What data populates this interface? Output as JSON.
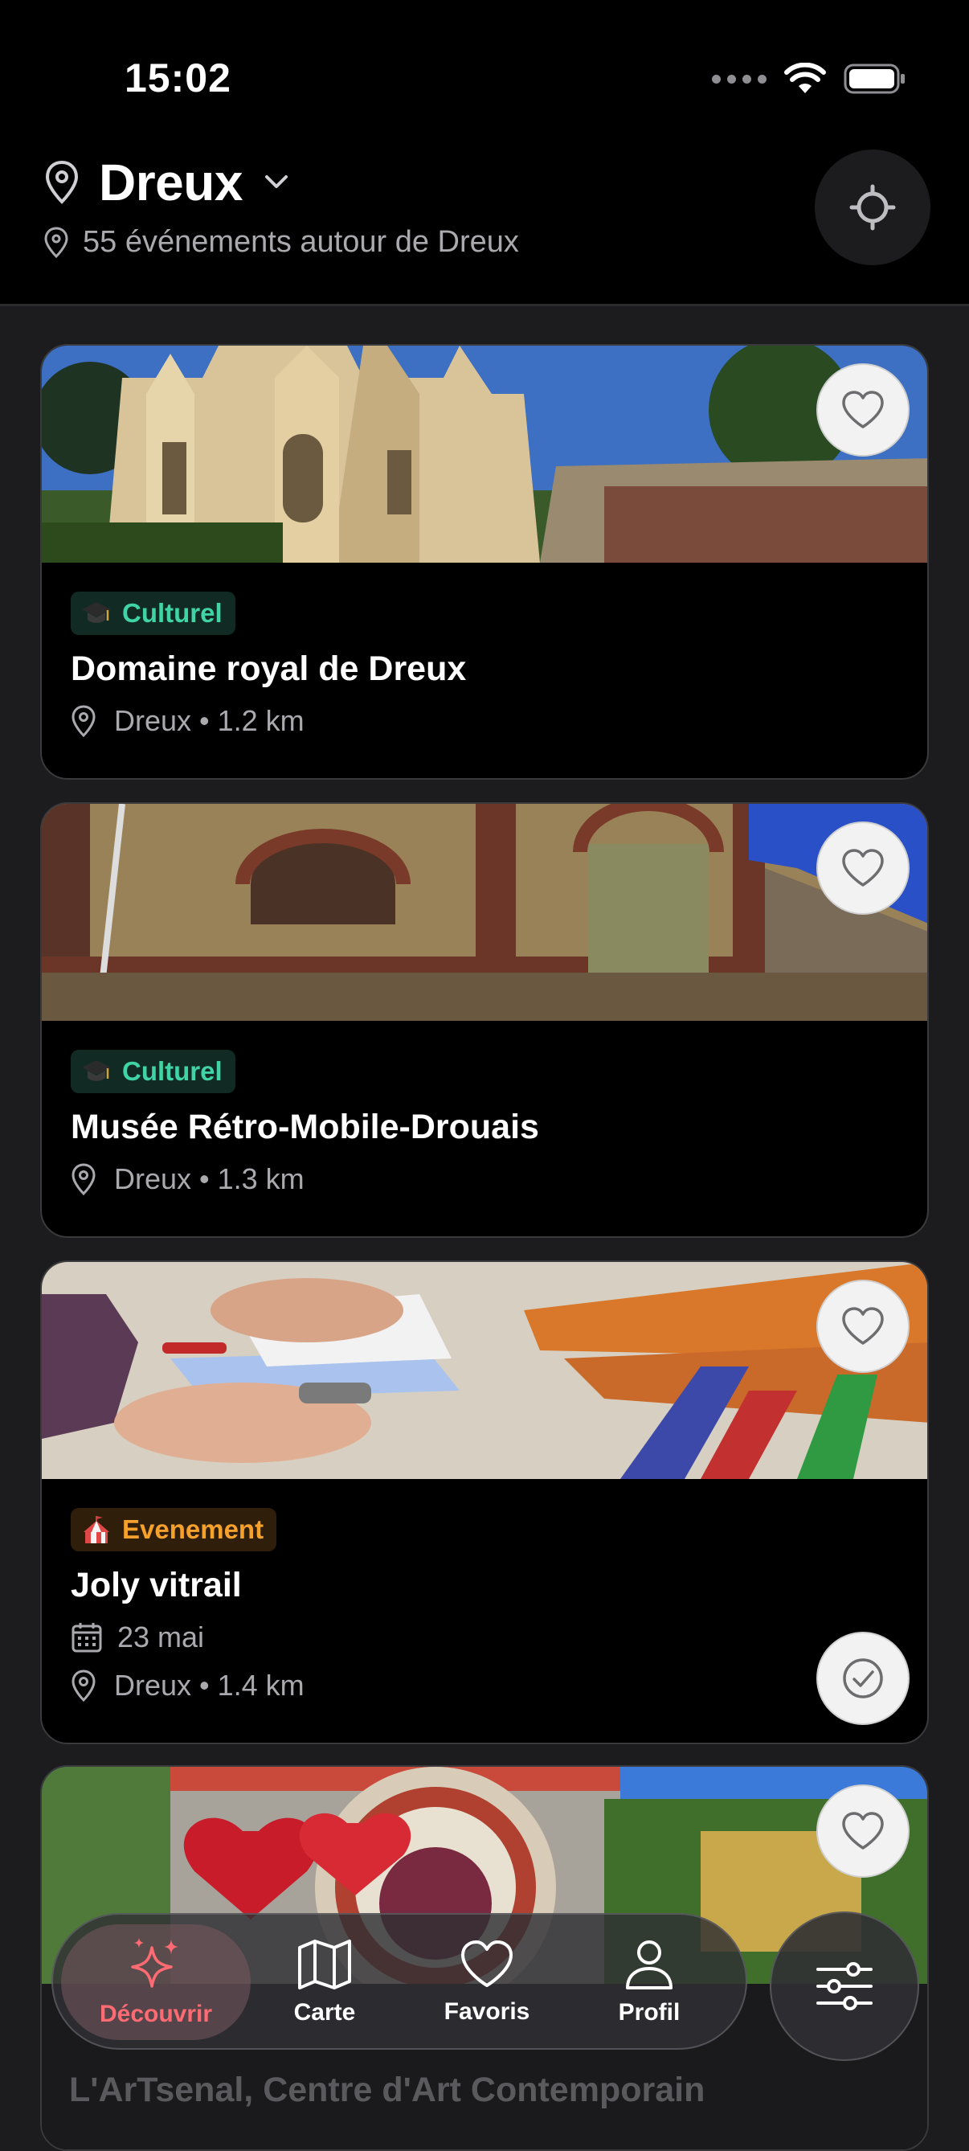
{
  "status_bar": {
    "time": "15:02"
  },
  "header": {
    "city": "Dreux",
    "subtitle": "55 événements autour de Dreux"
  },
  "cards": [
    {
      "category": "Culturel",
      "title": "Domaine royal de Dreux",
      "location": "Dreux • 1.2 km"
    },
    {
      "category": "Culturel",
      "title": "Musée Rétro-Mobile-Drouais",
      "location": "Dreux • 1.3 km"
    },
    {
      "category": "Evenement",
      "title": "Joly vitrail",
      "date": "23 mai",
      "location": "Dreux • 1.4 km"
    },
    {
      "title": "L'ArTsenal, Centre d'Art Contemporain"
    }
  ],
  "tabbar": {
    "tabs": [
      {
        "label": "Découvrir",
        "icon": "sparkles-icon",
        "active": true
      },
      {
        "label": "Carte",
        "icon": "map-icon"
      },
      {
        "label": "Favoris",
        "icon": "heart-icon"
      },
      {
        "label": "Profil",
        "icon": "person-icon"
      }
    ]
  },
  "colors": {
    "accent": "#ff6b72",
    "culturel": "#3fd3a5",
    "evenement": "#f6a12c"
  }
}
